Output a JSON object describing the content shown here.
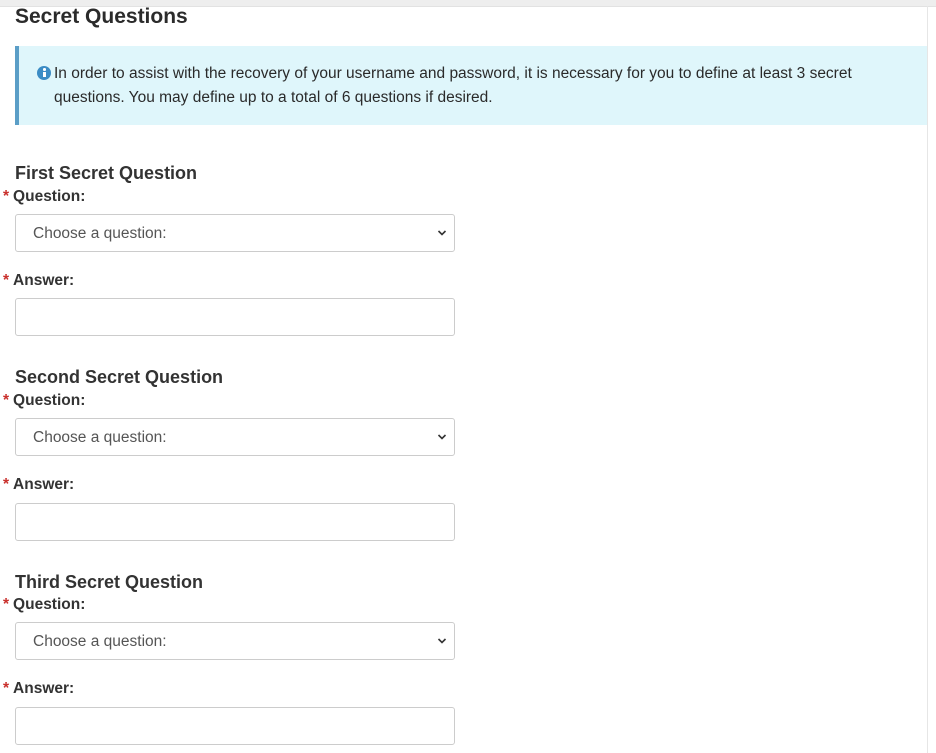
{
  "page": {
    "title": "Secret Questions"
  },
  "info": {
    "text": "In order to assist with the recovery of your username and password, it is necessary for you to define at least 3 secret questions. You may define up to a total of 6 questions if desired.",
    "icon": "info-circle-icon"
  },
  "required_marker": "*",
  "colors": {
    "info_background": "#dff6fb",
    "info_border": "#5b9ec7",
    "info_icon": "#3b8cc5",
    "required": "#c9302c",
    "input_border": "#cccccc"
  },
  "sections": [
    {
      "title": "First Secret Question",
      "question_label": "Question:",
      "question_value": "Choose a question:",
      "answer_label": "Answer:",
      "answer_value": ""
    },
    {
      "title": "Second Secret Question",
      "question_label": "Question:",
      "question_value": "Choose a question:",
      "answer_label": "Answer:",
      "answer_value": ""
    },
    {
      "title": "Third Secret Question",
      "question_label": "Question:",
      "question_value": "Choose a question:",
      "answer_label": "Answer:",
      "answer_value": ""
    }
  ]
}
